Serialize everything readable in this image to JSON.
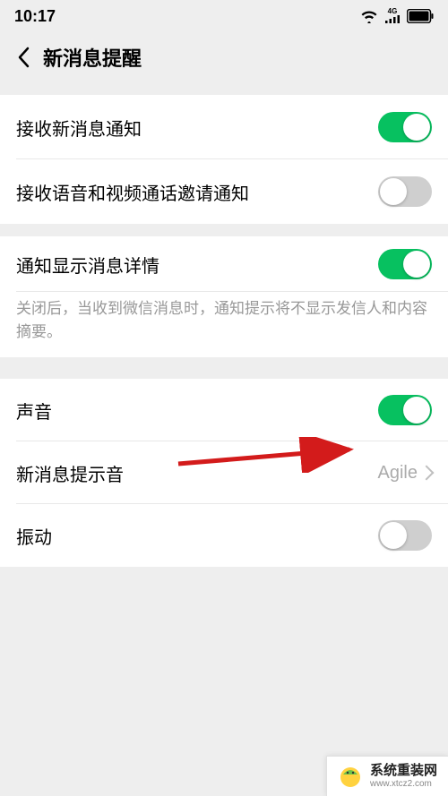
{
  "statusbar": {
    "time": "10:17"
  },
  "header": {
    "title": "新消息提醒"
  },
  "rows": {
    "receive_new_msg": {
      "label": "接收新消息通知"
    },
    "receive_voip": {
      "label": "接收语音和视频通话邀请通知"
    },
    "show_detail": {
      "label": "通知显示消息详情"
    },
    "detail_desc": "关闭后，当收到微信消息时，通知提示将不显示发信人和内容摘要。",
    "sound": {
      "label": "声音"
    },
    "sound_tone": {
      "label": "新消息提示音",
      "value": "Agile"
    },
    "vibrate": {
      "label": "振动"
    }
  },
  "watermark": {
    "main": "系统重装网",
    "sub": "www.xtcz2.com"
  }
}
